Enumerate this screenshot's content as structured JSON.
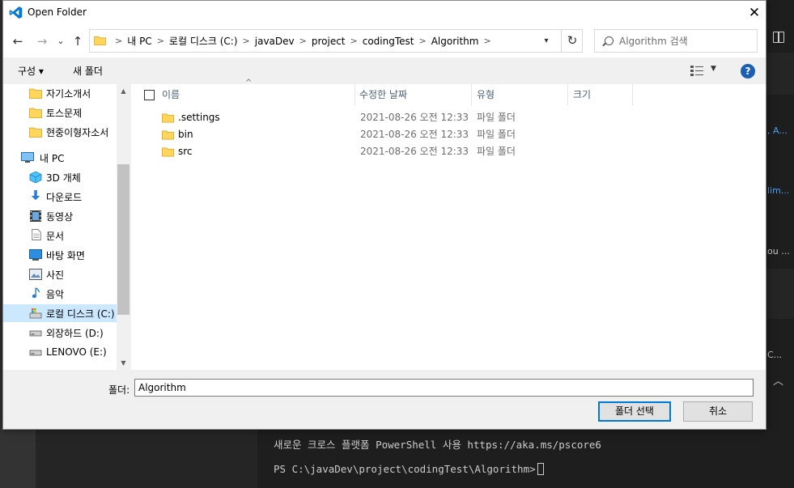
{
  "dialog": {
    "title": "Open Folder",
    "close_glyph": "✕"
  },
  "nav": {
    "back_glyph": "←",
    "forward_glyph": "→",
    "recent_glyph": "⌄",
    "up_glyph": "↑",
    "breadcrumb": [
      "내 PC",
      "로컬 디스크 (C:)",
      "javaDev",
      "project",
      "codingTest",
      "Algorithm"
    ],
    "search_placeholder": "Algorithm 검색"
  },
  "toolbar": {
    "organize_label": "구성 ▾",
    "new_folder_label": "새 폴더",
    "help_glyph": "?"
  },
  "sidebar": {
    "items": [
      {
        "label": "자기소개서",
        "icon": "folder-icon"
      },
      {
        "label": "토스문제",
        "icon": "folder-icon"
      },
      {
        "label": "현중이형자소서",
        "icon": "folder-icon"
      },
      {
        "label": "내 PC",
        "icon": "computer-icon"
      },
      {
        "label": "3D 개체",
        "icon": "3d-objects-icon"
      },
      {
        "label": "다운로드",
        "icon": "download-icon"
      },
      {
        "label": "동영상",
        "icon": "video-icon"
      },
      {
        "label": "문서",
        "icon": "document-icon"
      },
      {
        "label": "바탕 화면",
        "icon": "desktop-icon"
      },
      {
        "label": "사진",
        "icon": "picture-icon"
      },
      {
        "label": "음악",
        "icon": "music-icon"
      },
      {
        "label": "로컬 디스크 (C:)",
        "icon": "local-disk-icon"
      },
      {
        "label": "외장하드 (D:)",
        "icon": "drive-icon"
      },
      {
        "label": "LENOVO (E:)",
        "icon": "drive-icon"
      }
    ]
  },
  "list": {
    "columns": [
      "이름",
      "수정한 날짜",
      "유형",
      "크기"
    ],
    "rows": [
      {
        "name": ".settings",
        "date": "2021-08-26 오전 12:33",
        "type": "파일 폴더"
      },
      {
        "name": "bin",
        "date": "2021-08-26 오전 12:33",
        "type": "파일 폴더"
      },
      {
        "name": "src",
        "date": "2021-08-26 오전 12:33",
        "type": "파일 폴더"
      }
    ]
  },
  "footer": {
    "folder_label": "폴더:",
    "folder_value": "Algorithm",
    "select_button": "폴더 선택",
    "cancel_button": "취소"
  },
  "background": {
    "frag1": ", A...",
    "frag2": "lim...",
    "frag3": "ou ...",
    "frag4": "C...",
    "terminal_line1": "새로운 크로스 플랫폼 PowerShell 사용 https://aka.ms/pscore6",
    "terminal_prompt": "PS C:\\javaDev\\project\\codingTest\\Algorithm>"
  },
  "colors": {
    "accent": "#0078d7",
    "selection": "#cce8ff",
    "folder": "#ffd65c",
    "header_text": "#4c607a"
  }
}
